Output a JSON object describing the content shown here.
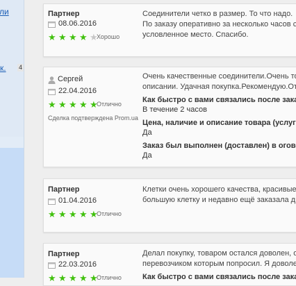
{
  "colors": {
    "star_filled": "#41c10e",
    "star_empty": "#c7c7c7",
    "link": "#1a5db5"
  },
  "sidebar": {
    "link_top": "ли",
    "link_mid": "к.",
    "badge": "4"
  },
  "reviews": [
    {
      "author": "Партнер",
      "date": "08.06.2016",
      "rating": 4,
      "rating_label": "Хорошо",
      "text": [
        "Соединители четко в размер. То что надо.",
        "По заказу оперативно за несколько часов собрали",
        "условленное место. Спасибо."
      ]
    },
    {
      "author": "Сергей",
      "date": "22.04.2016",
      "rating": 5,
      "rating_label": "Отлично",
      "verified": "Сделка подтверждена Prom.ua",
      "text": [
        "Очень качественные соединители.Очень точные",
        "описании. Удачная покупка.Рекомендую.Отлично"
      ],
      "qa": [
        {
          "q": "Как быстро с вами связались после заказа/со",
          "a": "В течение 2 часов"
        },
        {
          "q": "Цена, наличие и описание товара (услуги) был",
          "a": "Да"
        },
        {
          "q": "Заказ был выполнен (доставлен) в оговоренн",
          "a": "Да"
        }
      ]
    },
    {
      "author": "Партнер",
      "date": "01.04.2016",
      "rating": 5,
      "rating_label": "Отлично",
      "text": [
        "Клетки очень хорошего качества, красивые. Два",
        "большую клетку и недавно ещё заказала две. Отл"
      ]
    },
    {
      "author": "Партнер",
      "date": "22.03.2016",
      "rating": 5,
      "rating_label": "Отлично",
      "text": [
        "Делал покупку, товаром остался доволен, отправ",
        "перевозчиком которым попросил. Я доволен."
      ],
      "qa": [
        {
          "q": "Как быстро с вами связались после заказа/со",
          "a": ""
        }
      ]
    }
  ]
}
